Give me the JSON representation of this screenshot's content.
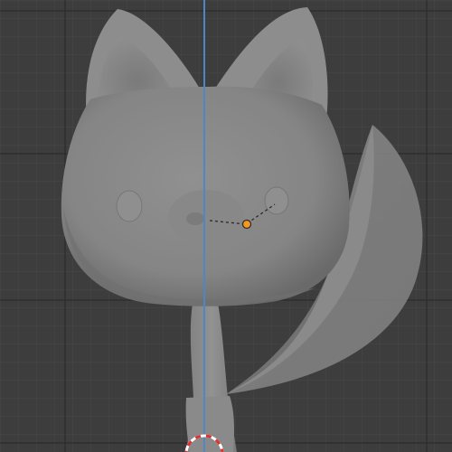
{
  "viewport": {
    "background_color": "#3d3d3d",
    "grid_color": "#4a4a4a",
    "major_grid_color": "#2c2c2c",
    "axis_color": "#4f86c6",
    "model_color": "#8a8a8a",
    "origin_color": "#f59a1f",
    "cursor_colors": [
      "#e03030",
      "#ffffff"
    ],
    "icons": {
      "origin": "object-origin-dot",
      "cursor": "3d-cursor"
    }
  }
}
